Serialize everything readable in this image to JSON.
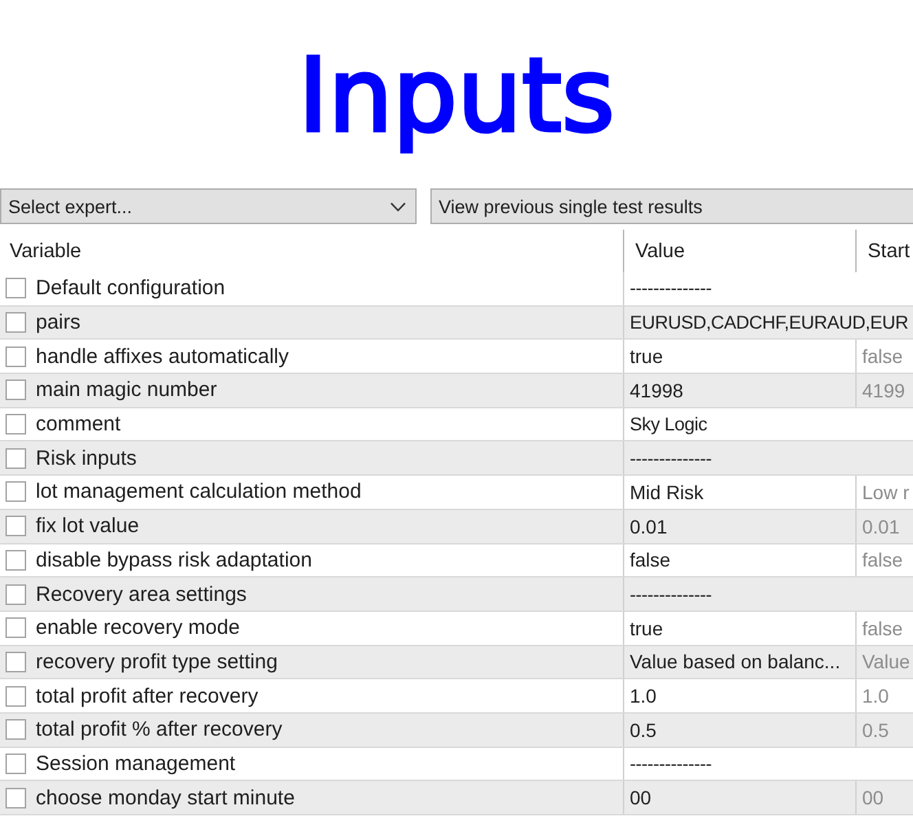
{
  "title": "Inputs",
  "toolbar": {
    "expert_dropdown": "Select expert...",
    "results_button": "View previous single test results"
  },
  "table": {
    "columns": [
      "Variable",
      "Value",
      "Start"
    ],
    "rows": [
      {
        "variable": "Default configuration",
        "checked": false,
        "value": "--------------"
      },
      {
        "variable": "pairs",
        "checked": false,
        "value": "EURUSD,CADCHF,EURAUD,EUR"
      },
      {
        "variable": "handle affixes automatically",
        "checked": false,
        "value": "true",
        "start": "false"
      },
      {
        "variable": "main magic number",
        "checked": false,
        "value": "41998",
        "start": "4199"
      },
      {
        "variable": "comment",
        "checked": false,
        "value": "Sky Logic"
      },
      {
        "variable": "Risk inputs",
        "checked": false,
        "value": "--------------"
      },
      {
        "variable": "lot management calculation method",
        "checked": false,
        "value": "Mid Risk",
        "start": "Low r"
      },
      {
        "variable": "fix lot value",
        "checked": false,
        "value": "0.01",
        "start": "0.01"
      },
      {
        "variable": "disable bypass risk adaptation",
        "checked": false,
        "value": "false",
        "start": "false"
      },
      {
        "variable": "Recovery area settings",
        "checked": false,
        "value": "--------------"
      },
      {
        "variable": "enable recovery mode",
        "checked": false,
        "value": "true",
        "start": "false"
      },
      {
        "variable": "recovery profit type setting",
        "checked": false,
        "value": "Value based on balanc...",
        "start": "Value"
      },
      {
        "variable": "total profit after recovery",
        "checked": false,
        "value": "1.0",
        "start": "1.0"
      },
      {
        "variable": "total profit % after recovery",
        "checked": false,
        "value": "0.5",
        "start": "0.5"
      },
      {
        "variable": "Session management",
        "checked": false,
        "value": "--------------"
      },
      {
        "variable": "choose monday start minute",
        "checked": false,
        "value": "00",
        "start": "00"
      }
    ]
  }
}
